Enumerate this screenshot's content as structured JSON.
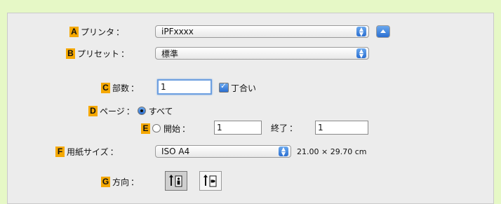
{
  "printer": {
    "badge": "A",
    "label": "プリンタ",
    "value": "iPFxxxx"
  },
  "preset": {
    "badge": "B",
    "label": "プリセット",
    "value": "標準"
  },
  "copies": {
    "badge": "C",
    "label": "部数",
    "value": "1",
    "collate_label": "丁合い",
    "collate_checked": true
  },
  "pages": {
    "badge": "D",
    "label": "ページ",
    "all_label": "すべて",
    "range_badge": "E",
    "from_label": "開始",
    "from_value": "1",
    "to_label": "終了",
    "to_value": "1"
  },
  "paper": {
    "badge": "F",
    "label": "用紙サイズ",
    "value": "ISO A4",
    "dimensions": "21.00 × 29.70 cm"
  },
  "orientation": {
    "badge": "G",
    "label": "方向"
  },
  "colon": "："
}
